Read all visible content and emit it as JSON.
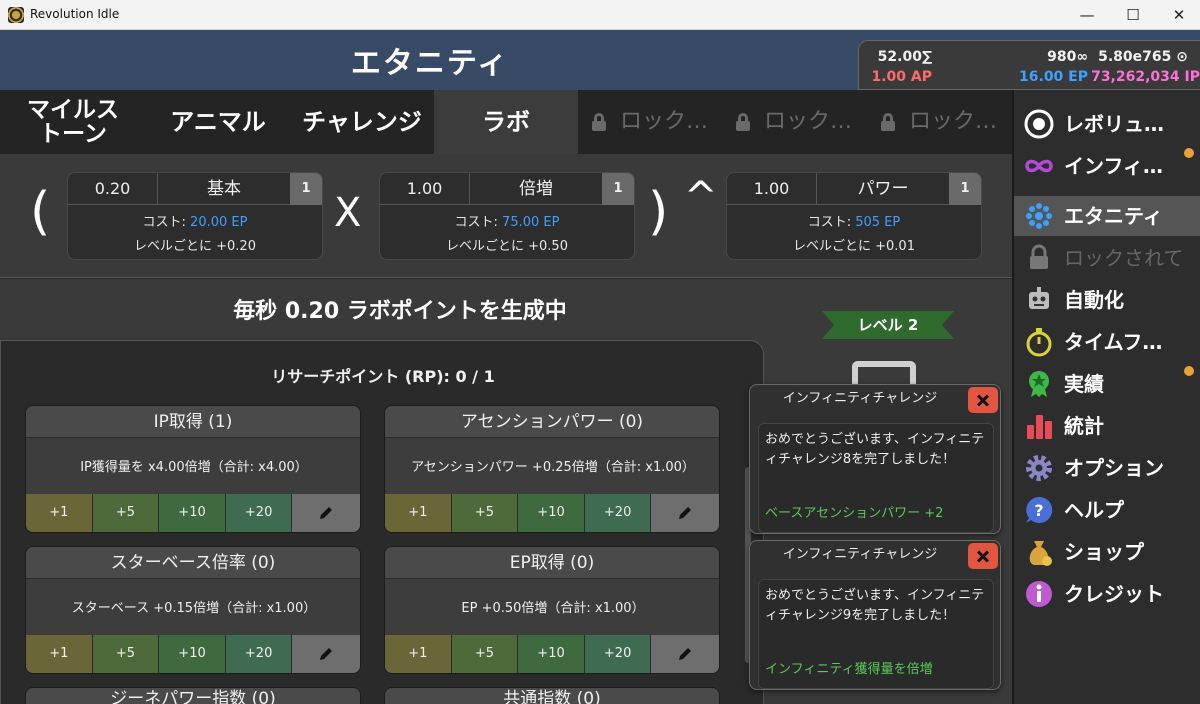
{
  "window": {
    "title": "Revolution Idle",
    "minimize": "—",
    "maximize": "☐",
    "close": "✕"
  },
  "header": {
    "title": "エタニティ",
    "resources": [
      {
        "top": "52.00∑",
        "bottom": "1.00 AP",
        "bottom_color": "#ff6b6b"
      },
      {
        "top": "980∞",
        "bottom": "16.00 EP",
        "bottom_color": "#3ea0ff"
      },
      {
        "top": "5.80e765 ⊙",
        "bottom": "73,262,034 IP",
        "bottom_color": "#ff6fd8"
      }
    ]
  },
  "tabs": [
    {
      "label": "マイルス\nトーン",
      "active": false
    },
    {
      "label": "アニマル",
      "active": false
    },
    {
      "label": "チャレンジ",
      "active": false
    },
    {
      "label": "ラボ",
      "active": true
    },
    {
      "label": "ロック…",
      "locked": true
    },
    {
      "label": "ロック…",
      "locked": true
    },
    {
      "label": "ロック…",
      "locked": true
    }
  ],
  "formula": {
    "open_paren": "(",
    "times": "X",
    "close_paren": ")",
    "power": "^",
    "boxes": [
      {
        "value": "0.20",
        "name": "基本",
        "level": "1",
        "cost_label": "コスト: ",
        "cost": "20.00 EP",
        "per_level": "レベルごとに +0.20"
      },
      {
        "value": "1.00",
        "name": "倍増",
        "level": "1",
        "cost_label": "コスト: ",
        "cost": "75.00 EP",
        "per_level": "レベルごとに +0.50"
      },
      {
        "value": "1.00",
        "name": "パワー",
        "level": "1",
        "cost_label": "コスト: ",
        "cost": "505 EP",
        "per_level": "レベルごとに +0.01"
      }
    ]
  },
  "main": {
    "generating": "毎秒 0.20 ラボポイントを生成中",
    "research_points": "リサーチポイント (RP): 0 / 1",
    "level_badge": "レベル 2",
    "cards": [
      {
        "title": "IP取得 (1)",
        "desc": "IP獲得量を x4.00倍増（合計: x4.00）"
      },
      {
        "title": "アセンションパワー (0)",
        "desc": "アセンションパワー +0.25倍増（合計: x1.00）"
      },
      {
        "title": "スターベース倍率 (0)",
        "desc": "スターベース +0.15倍増（合計: x1.00）"
      },
      {
        "title": "EP取得 (0)",
        "desc": "EP +0.50倍増（合計: x1.00）"
      }
    ],
    "partial_cards": [
      "ジーネパワー指数 (0)",
      "共通指数 (0)"
    ],
    "buttons": [
      "+1",
      "+5",
      "+10",
      "+20"
    ]
  },
  "notifications": [
    {
      "title": "インフィニティチャレンジ",
      "message": "おめでとうございます、インフィニティチャレンジ8を完了しました！",
      "reward": "ベースアセンションパワー +2"
    },
    {
      "title": "インフィニティチャレンジ",
      "message": "おめでとうございます、インフィニティチャレンジ9を完了しました！",
      "reward": "インフィニティ獲得量を倍増"
    }
  ],
  "sidebar": [
    {
      "label": "レボリュ…",
      "icon": "revolution-icon"
    },
    {
      "label": "インフィ…",
      "icon": "infinity-icon",
      "dot": true
    },
    {
      "label": "エタニティ",
      "icon": "eternity-icon",
      "active": true
    },
    {
      "label": "ロックされて",
      "icon": "lock-icon",
      "locked": true
    },
    {
      "label": "自動化",
      "icon": "robot-icon"
    },
    {
      "label": "タイムフ…",
      "icon": "stopwatch-icon"
    },
    {
      "label": "実績",
      "icon": "achievement-icon",
      "dot": true
    },
    {
      "label": "統計",
      "icon": "stats-icon"
    },
    {
      "label": "オプション",
      "icon": "gear-icon"
    },
    {
      "label": "ヘルプ",
      "icon": "help-icon"
    },
    {
      "label": "ショップ",
      "icon": "shop-icon"
    },
    {
      "label": "クレジット",
      "icon": "info-icon"
    }
  ]
}
